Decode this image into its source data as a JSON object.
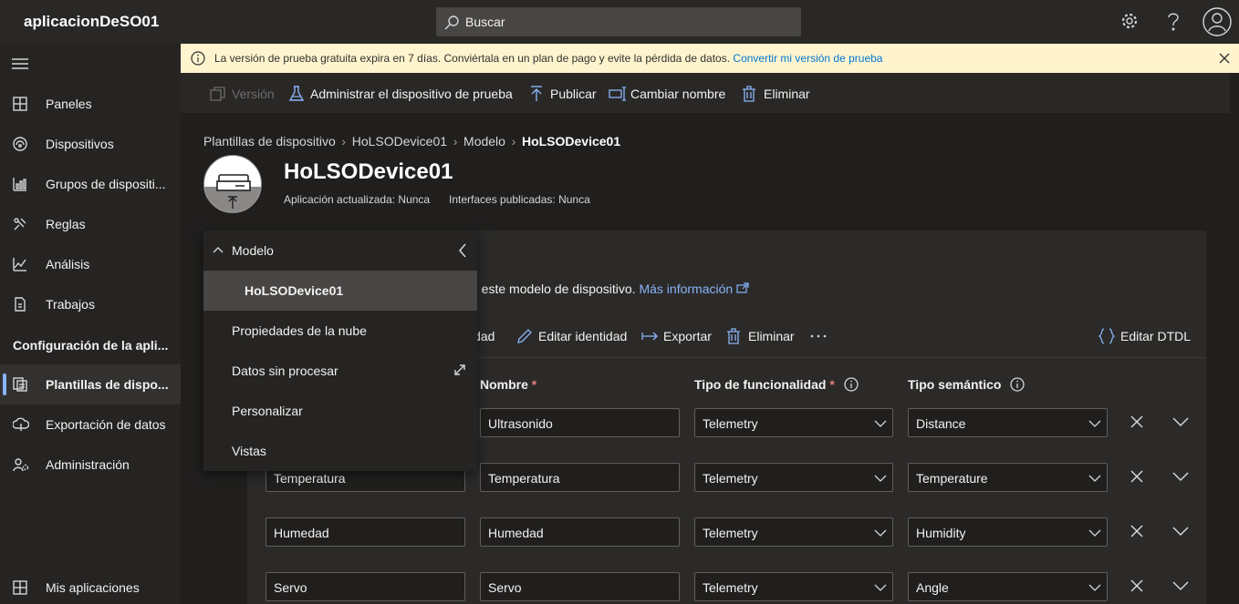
{
  "app": {
    "title": "aplicacionDeSO01"
  },
  "search": {
    "placeholder": "Buscar"
  },
  "nav": {
    "items": [
      {
        "label": "Paneles"
      },
      {
        "label": "Dispositivos"
      },
      {
        "label": "Grupos de dispositi..."
      },
      {
        "label": "Reglas"
      },
      {
        "label": "Análisis"
      },
      {
        "label": "Trabajos"
      }
    ],
    "section_label": "Configuración de la apli...",
    "config_items": [
      {
        "label": "Plantillas de dispo..."
      },
      {
        "label": "Exportación de datos"
      },
      {
        "label": "Administración"
      }
    ],
    "bottom_item": "Mis aplicaciones"
  },
  "banner": {
    "message": "La versión de prueba gratuita expira en 7 días. Conviértala en un plan de pago y evite la pérdida de datos.",
    "link": "Convertir mi versión de prueba"
  },
  "commands": {
    "version": "Versión",
    "manage": "Administrar el dispositivo de prueba",
    "publish": "Publicar",
    "rename": "Cambiar nombre",
    "delete": "Eliminar"
  },
  "breadcrumb": {
    "items": [
      "Plantillas de dispositivo",
      "HoLSODevice01",
      "Modelo"
    ],
    "current": "HoLSODevice01"
  },
  "device": {
    "name": "HoLSODevice01",
    "app_updated": "Aplicación actualizada: Nunca",
    "interfaces_published": "Interfaces publicadas: Nunca"
  },
  "panel": {
    "title_partial": "r",
    "desc_partial": "n este modelo de dispositivo.",
    "more_info": "Más información"
  },
  "toolbar": {
    "identity_partial": "idad",
    "edit_identity": "Editar identidad",
    "export": "Exportar",
    "delete": "Eliminar",
    "edit_dtdl": "Editar DTDL"
  },
  "grid": {
    "col_name": "Nombre",
    "col_type": "Tipo de funcionalidad",
    "col_semantic": "Tipo semántico",
    "required_mark": "*",
    "rows": [
      {
        "display": "",
        "name": "Ultrasonido",
        "type": "Telemetry",
        "semantic": "Distance"
      },
      {
        "display": "Temperatura",
        "name": "Temperatura",
        "type": "Telemetry",
        "semantic": "Temperature"
      },
      {
        "display": "Humedad",
        "name": "Humedad",
        "type": "Telemetry",
        "semantic": "Humidity"
      },
      {
        "display": "Servo",
        "name": "Servo",
        "type": "Telemetry",
        "semantic": "Angle"
      }
    ]
  },
  "flyout": {
    "header": "Modelo",
    "items": [
      "HoLSODevice01",
      "Propiedades de la nube",
      "Datos sin procesar",
      "Personalizar",
      "Vistas"
    ]
  },
  "colors": {
    "accent": "#8ab4f8",
    "banner_bg": "#fff4ce",
    "link": "#0078d4",
    "required": "#e37d80"
  }
}
